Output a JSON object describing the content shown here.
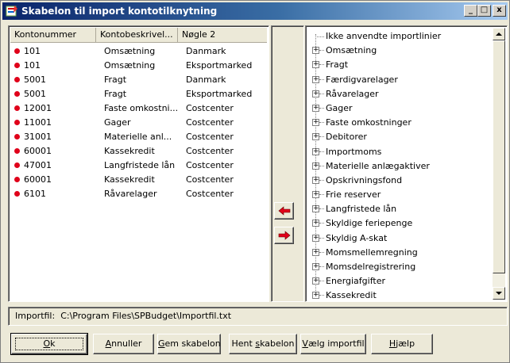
{
  "window": {
    "title": "Skabelon til import kontotilknytning",
    "controls": {
      "minimize": "_",
      "maximize": "□",
      "close": "x"
    }
  },
  "accounts_list": {
    "columns": [
      "Kontonummer",
      "Kontobeskrivel...",
      "Nøgle 2"
    ],
    "rows": [
      {
        "number": "101",
        "description": "Omsætning",
        "key2": "Danmark"
      },
      {
        "number": "101",
        "description": "Omsætning",
        "key2": "Eksportmarked"
      },
      {
        "number": "5001",
        "description": "Fragt",
        "key2": "Danmark"
      },
      {
        "number": "5001",
        "description": "Fragt",
        "key2": "Eksportmarked"
      },
      {
        "number": "12001",
        "description": "Faste omkostni...",
        "key2": "Costcenter"
      },
      {
        "number": "11001",
        "description": "Gager",
        "key2": "Costcenter"
      },
      {
        "number": "31001",
        "description": "Materielle anl...",
        "key2": "Costcenter"
      },
      {
        "number": "60001",
        "description": "Kassekredit",
        "key2": "Costcenter"
      },
      {
        "number": "47001",
        "description": "Langfristede lån",
        "key2": "Costcenter"
      },
      {
        "number": "60001",
        "description": "Kassekredit",
        "key2": "Costcenter"
      },
      {
        "number": "6101",
        "description": "Råvarelager",
        "key2": "Costcenter"
      }
    ],
    "status_color": "#e0001a"
  },
  "transfer": {
    "left_icon": "arrow-left-icon",
    "right_icon": "arrow-right-icon"
  },
  "tree": {
    "root": "Ikke anvendte importlinier",
    "items": [
      "Omsætning",
      "Fragt",
      "Færdigvarelager",
      "Råvarelager",
      "Gager",
      "Faste omkostninger",
      "Debitorer",
      "Importmoms",
      "Materielle anlægaktiver",
      "Opskrivningsfond",
      "Frie reserver",
      "Langfristede lån",
      "Skyldige feriepenge",
      "Skyldig A-skat",
      "Momsmellemregning",
      "Momsdelregistrering",
      "Energiafgifter",
      "Kassekredit"
    ]
  },
  "status": {
    "label": "Importfil:",
    "path": "C:\\Program Files\\SPBudget\\Importfil.txt"
  },
  "buttons": {
    "ok": {
      "label": "Ok",
      "u": "O",
      "rest": "k"
    },
    "cancel": {
      "label": "Annuller",
      "u": "A",
      "rest": "nnuller"
    },
    "save_template": {
      "label": "Gem skabelon",
      "u": "G",
      "rest": "em skabelon"
    },
    "load_template": {
      "label": "Hent skabelon",
      "pre": "Hent ",
      "u": "s",
      "rest": "kabelon"
    },
    "select_file": {
      "label": "Vælg importfil",
      "u": "V",
      "rest": "ælg importfil"
    },
    "help": {
      "label": "Hjælp",
      "u": "H",
      "rest": "jælp"
    }
  },
  "colors": {
    "title_start": "#0a246a",
    "title_end": "#a6caf0",
    "face": "#ece9d8",
    "arrow": "#e0001a"
  }
}
